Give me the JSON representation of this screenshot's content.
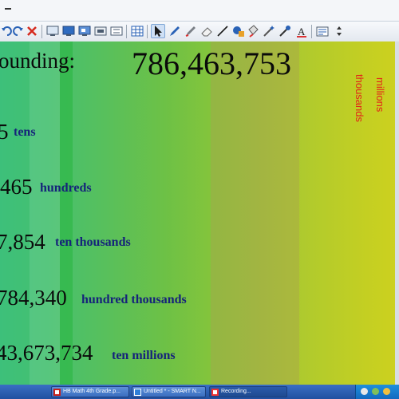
{
  "toolbar": {
    "buttons": [
      "undo",
      "redo",
      "delete",
      "screen-shade",
      "display",
      "capture",
      "record",
      "table",
      "select",
      "pen",
      "creative-pen",
      "eraser",
      "line",
      "shape",
      "fill",
      "magic-pen",
      "recognition",
      "text",
      "properties",
      "more"
    ]
  },
  "canvas": {
    "heading": "ounding:",
    "big_number": "786,463,753",
    "place_labels": {
      "millions": "millions",
      "thousands": "thousands"
    },
    "rows": [
      {
        "number": "5",
        "label": "tens"
      },
      {
        "number": "465",
        "label": "hundreds"
      },
      {
        "number": "7,854",
        "label": "ten thousands"
      },
      {
        "number": "784,340",
        "label": "hundred thousands"
      },
      {
        "number": "43,673,734",
        "label": "ten millions"
      }
    ],
    "colors": {
      "red_label": "#e32418",
      "label_blue": "#15237a"
    }
  },
  "taskbar": {
    "tasks": [
      "HB Math 4th Grade.p...",
      "Untitled * - SMART N...",
      "Recording..."
    ]
  }
}
